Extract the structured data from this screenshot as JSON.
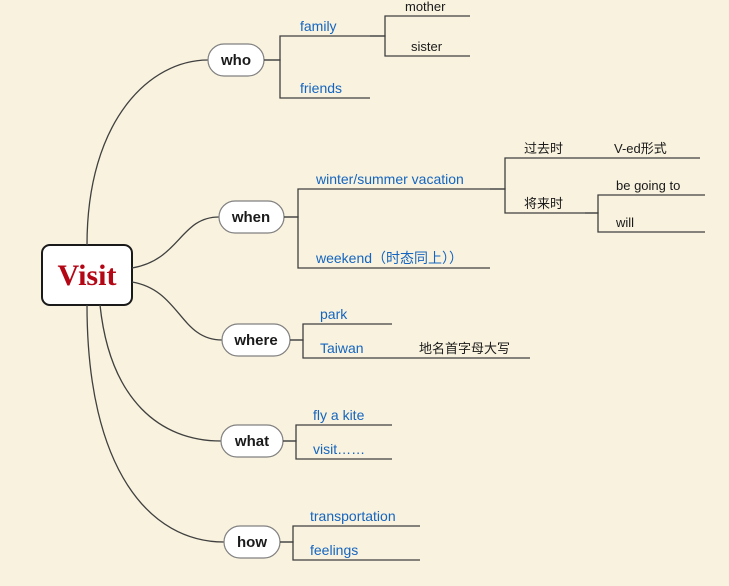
{
  "root": {
    "label": "Visit"
  },
  "branches": {
    "who": {
      "label": "who",
      "children": {
        "family": {
          "label": "family",
          "children": {
            "mother": "mother",
            "sister": "sister"
          }
        },
        "friends": {
          "label": "friends"
        }
      }
    },
    "when": {
      "label": "when",
      "children": {
        "vacation": {
          "label": "winter/summer vacation",
          "children": {
            "past": {
              "label": "过去时",
              "ved": "V-ed形式"
            },
            "future": {
              "label": "将来时",
              "begoingto": "be going to",
              "will": "will"
            }
          }
        },
        "weekend": {
          "label": "weekend（时态同上））"
        }
      }
    },
    "where": {
      "label": "where",
      "children": {
        "park": {
          "label": "park"
        },
        "taiwan": {
          "label": "Taiwan",
          "note": "地名首字母大写"
        }
      }
    },
    "what": {
      "label": "what",
      "children": {
        "fly": "fly a kite",
        "visit": "visit……"
      }
    },
    "how": {
      "label": "how",
      "children": {
        "transportation": "transportation",
        "feelings": "feelings"
      }
    }
  }
}
